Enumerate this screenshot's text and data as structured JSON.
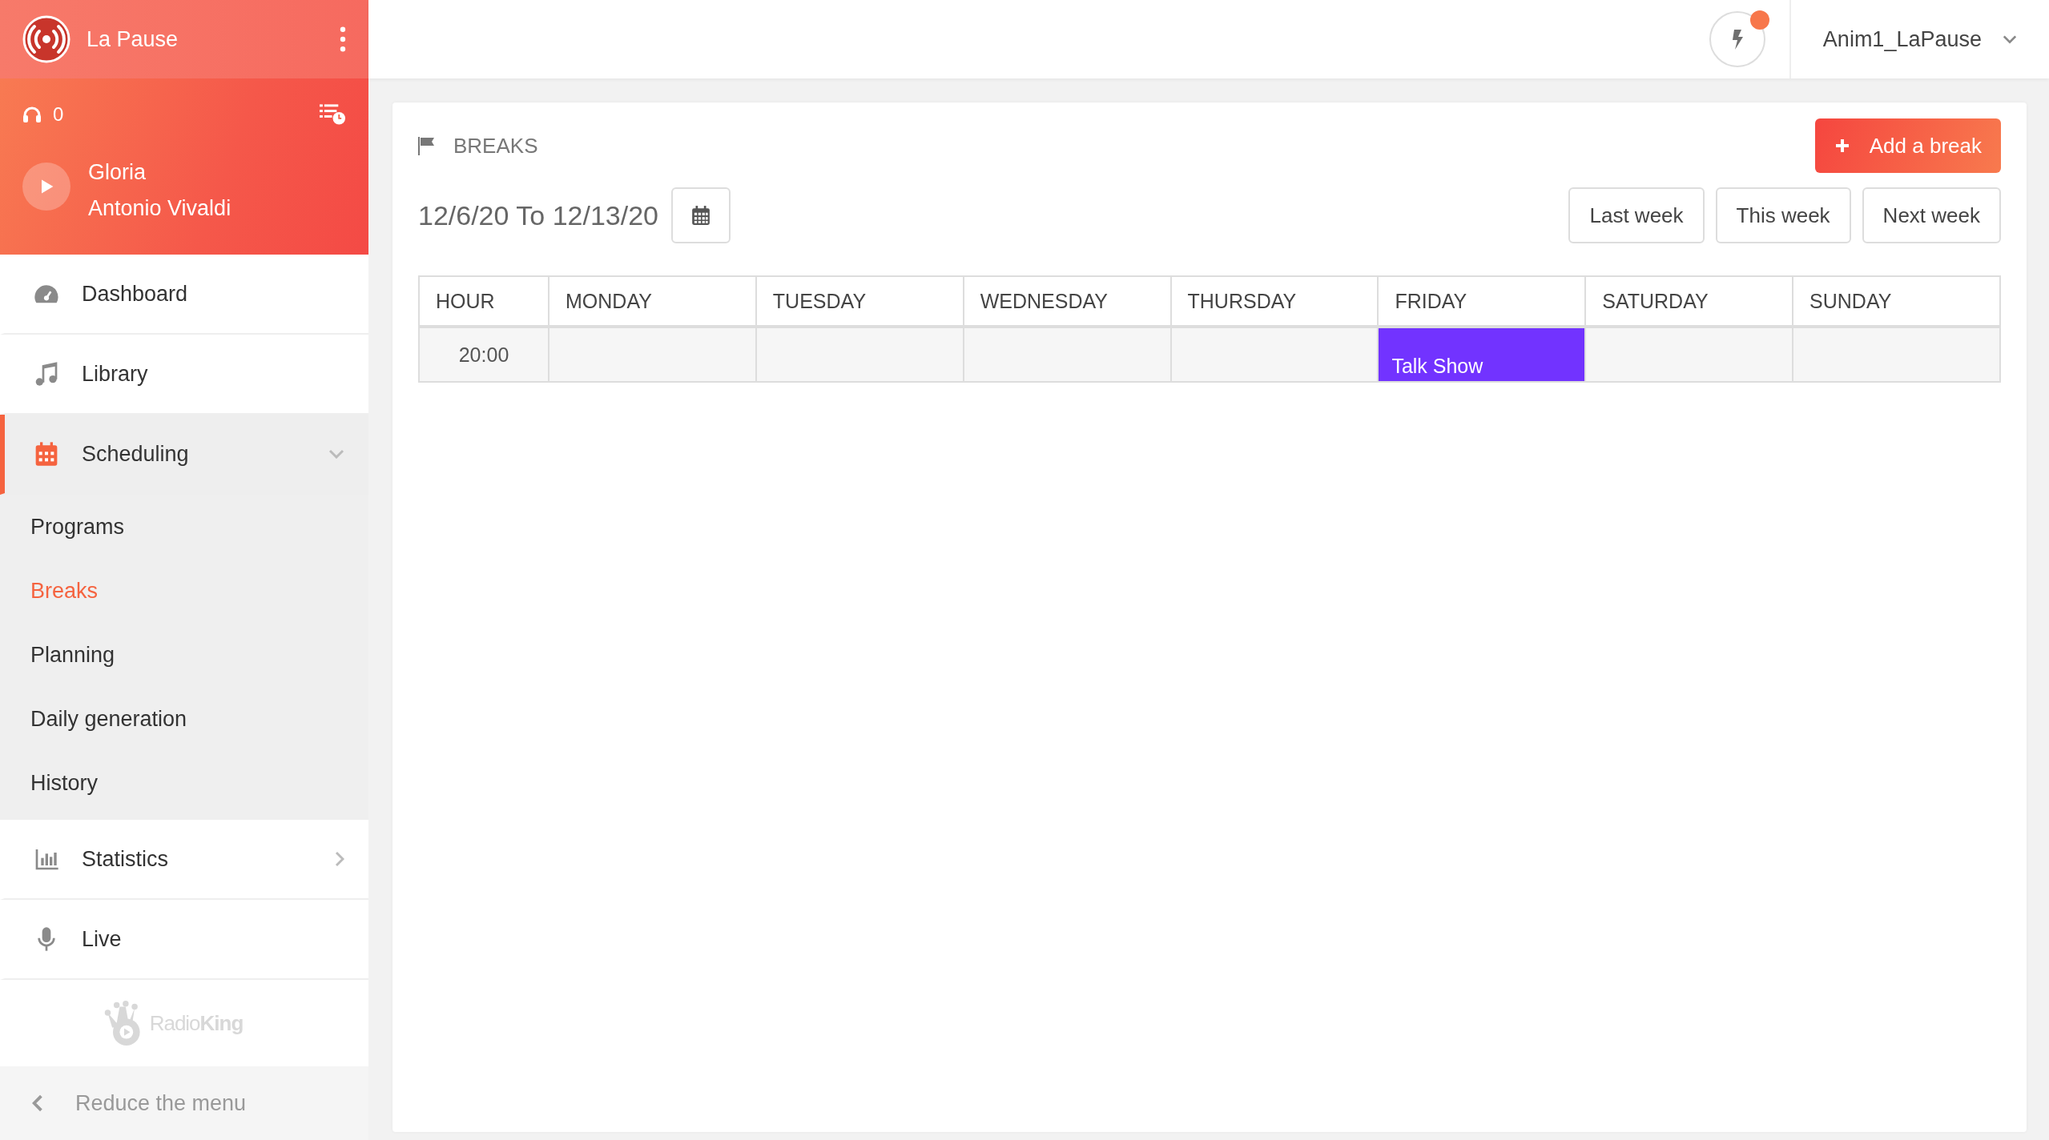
{
  "station": {
    "name": "La Pause"
  },
  "player": {
    "listeners": "0",
    "title": "Gloria",
    "artist": "Antonio Vivaldi"
  },
  "nav": [
    {
      "label": "Dashboard",
      "selected": false
    },
    {
      "label": "Library",
      "selected": false
    },
    {
      "label": "Scheduling",
      "selected": true,
      "expanded": true,
      "children": [
        {
          "label": "Programs",
          "selected": false
        },
        {
          "label": "Breaks",
          "selected": true
        },
        {
          "label": "Planning",
          "selected": false
        },
        {
          "label": "Daily generation",
          "selected": false
        },
        {
          "label": "History",
          "selected": false
        }
      ]
    },
    {
      "label": "Statistics",
      "selected": false,
      "expanded": false
    },
    {
      "label": "Live",
      "selected": false
    }
  ],
  "brand": "Radio**King**",
  "reduce_menu": "Reduce the menu",
  "topbar": {
    "notification": true,
    "user": "Anim1_LaPause"
  },
  "page": {
    "title": "BREAKS",
    "add_button": "Add a break",
    "date_range": "12/6/20 To 12/13/20",
    "week_buttons": [
      "Last week",
      "This week",
      "Next week"
    ]
  },
  "table": {
    "columns": [
      "HOUR",
      "MONDAY",
      "TUESDAY",
      "WEDNESDAY",
      "THURSDAY",
      "FRIDAY",
      "SATURDAY",
      "SUNDAY"
    ],
    "rows": [
      {
        "cells": [
          "20:00",
          "",
          "",
          "",
          "",
          {
            "label": "Talk Show",
            "color": "#7233ff"
          },
          "",
          ""
        ]
      }
    ]
  }
}
